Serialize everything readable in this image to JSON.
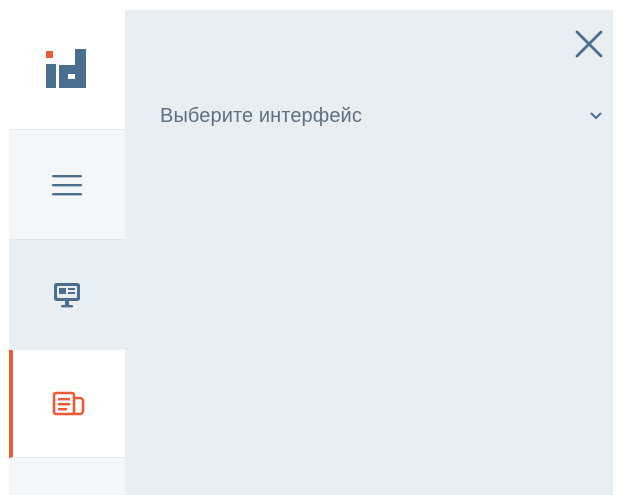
{
  "colors": {
    "accent": "#ea5b36",
    "logo_blue": "#4a6f8e",
    "icon_blue": "#4a6f8e",
    "panel_bg": "#e9eef3",
    "text": "#5f6f80"
  },
  "rail": {
    "logo": {
      "icon": "logo-icon"
    },
    "items": [
      {
        "icon": "menu-icon",
        "active": false
      },
      {
        "icon": "monitor-icon",
        "active": false
      },
      {
        "icon": "news-icon",
        "active": true
      }
    ]
  },
  "panel": {
    "close_icon": "close-icon",
    "select": {
      "label": "Выберите интерфейс",
      "icon": "chevron-down-icon"
    }
  }
}
